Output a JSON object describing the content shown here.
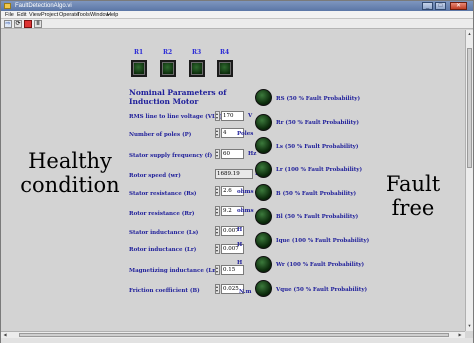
{
  "window": {
    "title": "FaultDetectionAlgo.vi",
    "menu": [
      "File",
      "Edit",
      "View",
      "Project",
      "Operate",
      "Tools",
      "Window",
      "Help"
    ],
    "buttons": {
      "minimize": "_",
      "maximize": "□",
      "close": "✕"
    }
  },
  "toolbar": {
    "run": "⇨",
    "run_continuously": "⟳",
    "abort": "●",
    "pause": "II"
  },
  "left_label": "Healthy condition",
  "right_label": "Fault free",
  "relays": [
    {
      "label": "R1",
      "state": "off"
    },
    {
      "label": "R2",
      "state": "off"
    },
    {
      "label": "R3",
      "state": "off"
    },
    {
      "label": "R4",
      "state": "off"
    }
  ],
  "panel_title": "Nominal Parameters of Induction Motor",
  "parameters": [
    {
      "label": "RMS line to line voltage (VLL)",
      "value": "170",
      "unit": "V",
      "indicator": false
    },
    {
      "label": "Number of poles (P)",
      "value": "4",
      "unit": "Poles",
      "indicator": false
    },
    {
      "label": "Stator supply frequency  (f)",
      "value": "60",
      "unit": "Hz",
      "indicator": false
    },
    {
      "label": "Rotor speed  (wr)",
      "value": "1689.19",
      "unit": "Rpm",
      "indicator": true
    },
    {
      "label": "Stator resistance (Rs)",
      "value": "2.6",
      "unit": "ohms",
      "indicator": false
    },
    {
      "label": "Rotor resistance (Rr)",
      "value": "9.2",
      "unit": "ohms",
      "indicator": false
    },
    {
      "label": "Stator inductance (Ls)",
      "value": "0.007",
      "unit": "H",
      "indicator": false
    },
    {
      "label": "Rotor inductance (Lr)",
      "value": "0.007",
      "unit": "H",
      "indicator": false
    },
    {
      "label": "Magnetizing inductance (Lm)",
      "value": "0.15",
      "unit": "H",
      "indicator": false
    },
    {
      "label": "Friction coefficient (B)",
      "value": "0.025",
      "unit": "N.m",
      "indicator": false
    }
  ],
  "fault_indicators": [
    {
      "label": "RS  (50 % Fault Probability)",
      "state": "off"
    },
    {
      "label": "Rr (50 % Fault Probability)",
      "state": "off"
    },
    {
      "label": "Ls (50 % Fault Probability)",
      "state": "off"
    },
    {
      "label": "Lr (100 % Fault Probability)",
      "state": "off"
    },
    {
      "label": "B  (50 % Fault Probability)",
      "state": "off"
    },
    {
      "label": "Bl (50 % Fault Probability)",
      "state": "off"
    },
    {
      "label": "Ique (100 % Fault Probability)",
      "state": "off"
    },
    {
      "label": "Wr (100 % Fault Probability)",
      "state": "off"
    },
    {
      "label": "Vque (50 % Fault Probability)",
      "state": "off"
    }
  ],
  "colors": {
    "label_blue": "#1e1e9a",
    "relay_label": "#2b2bd6",
    "led_off": "#0b2a0b"
  }
}
